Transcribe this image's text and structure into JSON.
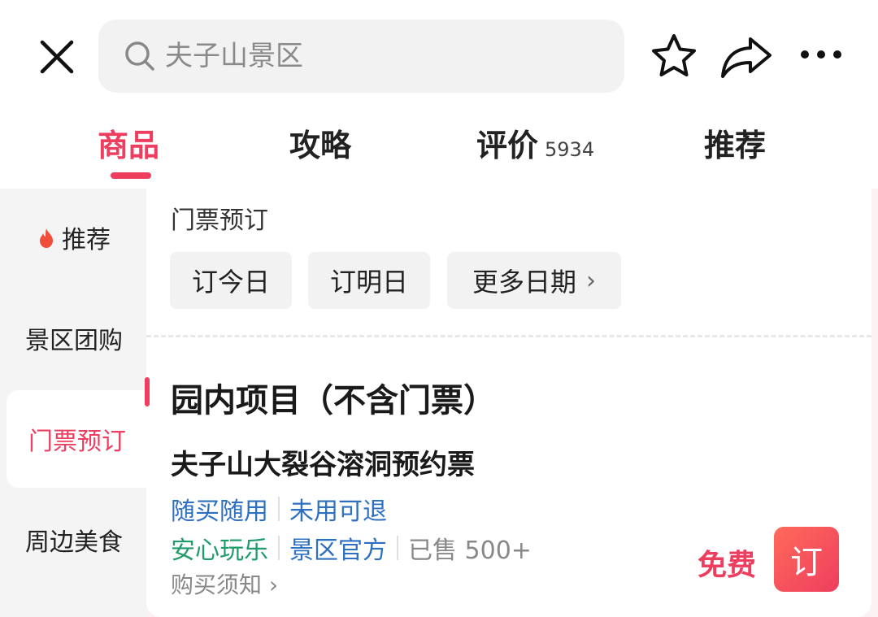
{
  "header": {
    "search_text": "夫子山景区"
  },
  "tabs": [
    {
      "label": "商品"
    },
    {
      "label": "攻略"
    },
    {
      "label": "评价",
      "count": "5934"
    },
    {
      "label": "推荐"
    }
  ],
  "sidebar": {
    "items": [
      {
        "label": "推荐"
      },
      {
        "label": "景区团购"
      },
      {
        "label": "门票预订"
      },
      {
        "label": "周边美食"
      }
    ]
  },
  "ticket_booking": {
    "title": "门票预订",
    "date_buttons": [
      "订今日",
      "订明日",
      "更多日期"
    ],
    "chevron": "›"
  },
  "park_items": {
    "title": "园内项目（不含门票）",
    "product": {
      "name": "夫子山大裂谷溶洞预约票",
      "tags_row1": [
        "随买随用",
        "未用可退"
      ],
      "tags_row2": [
        "安心玩乐",
        "景区官方"
      ],
      "sold": "已售 500+",
      "notice": "购买须知 ›",
      "price": "免费",
      "order_label": "订"
    }
  },
  "colors": {
    "accent": "#ee3e5f",
    "blue_tag": "#2d6fc0",
    "green_tag": "#1f9c6a"
  }
}
